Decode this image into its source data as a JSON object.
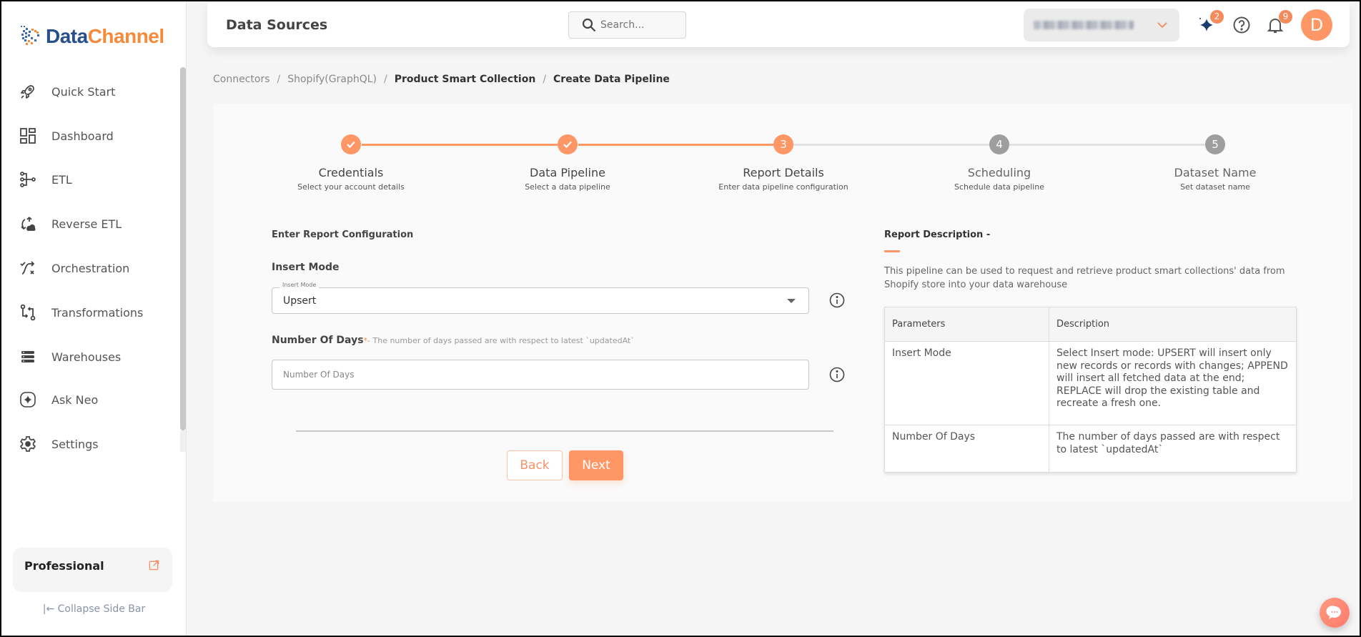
{
  "brand": {
    "part1": "Data",
    "part2": "Channel"
  },
  "sidebar": {
    "items": [
      {
        "label": "Quick Start",
        "icon": "rocket-icon"
      },
      {
        "label": "Dashboard",
        "icon": "dashboard-icon"
      },
      {
        "label": "ETL",
        "icon": "etl-icon"
      },
      {
        "label": "Reverse ETL",
        "icon": "reverse-etl-icon"
      },
      {
        "label": "Orchestration",
        "icon": "orchestration-icon"
      },
      {
        "label": "Transformations",
        "icon": "transformations-icon"
      },
      {
        "label": "Warehouses",
        "icon": "warehouses-icon"
      },
      {
        "label": "Ask Neo",
        "icon": "ask-neo-icon"
      },
      {
        "label": "Settings",
        "icon": "gear-icon"
      }
    ],
    "plan": "Professional",
    "collapse_label": "|← Collapse Side Bar"
  },
  "header": {
    "title": "Data Sources",
    "search_placeholder": "Search...",
    "workspace_name": "(blurred)",
    "neo_badge": "2",
    "notifications_badge": "9",
    "avatar_initial": "D"
  },
  "breadcrumb": [
    {
      "label": "Connectors",
      "strong": false
    },
    {
      "label": "Shopify(GraphQL)",
      "strong": false
    },
    {
      "label": "Product Smart Collection",
      "strong": true
    },
    {
      "label": "Create Data Pipeline",
      "strong": true
    }
  ],
  "stepper": {
    "current_step": 3,
    "steps": [
      {
        "number": "1",
        "title": "Credentials",
        "subtitle": "Select your account details",
        "status": "done"
      },
      {
        "number": "2",
        "title": "Data Pipeline",
        "subtitle": "Select a data pipeline",
        "status": "done"
      },
      {
        "number": "3",
        "title": "Report Details",
        "subtitle": "Enter data pipeline configuration",
        "status": "active"
      },
      {
        "number": "4",
        "title": "Scheduling",
        "subtitle": "Schedule data pipeline",
        "status": "pending"
      },
      {
        "number": "5",
        "title": "Dataset Name",
        "subtitle": "Set dataset name",
        "status": "pending"
      }
    ]
  },
  "form": {
    "section_title": "Enter Report Configuration",
    "insert_mode": {
      "label": "Insert Mode",
      "legend": "Insert Mode",
      "value": "Upsert"
    },
    "number_of_days": {
      "label": "Number Of Days",
      "required_mark": "*",
      "hint": "- The number of days passed are with respect to latest `updatedAt`",
      "placeholder": "Number Of Days",
      "value": ""
    },
    "back_label": "Back",
    "next_label": "Next"
  },
  "description": {
    "title": "Report Description -",
    "text": "This pipeline can be used to request and retrieve product smart collections' data from Shopify store into your data warehouse",
    "table": {
      "headers": [
        "Parameters",
        "Description"
      ],
      "rows": [
        [
          "Insert Mode",
          "Select Insert mode: UPSERT will insert only new records or records with changes; APPEND will insert all fetched data at the end; REPLACE will drop the existing table and recreate a fresh one."
        ],
        [
          "Number Of Days",
          "The number of days passed are with respect to latest `updatedAt`"
        ]
      ]
    }
  },
  "colors": {
    "accent": "#ff9666",
    "pending_step": "#9e9e9e",
    "brand_blue": "#264f8c",
    "brand_orange": "#f58a3b"
  }
}
